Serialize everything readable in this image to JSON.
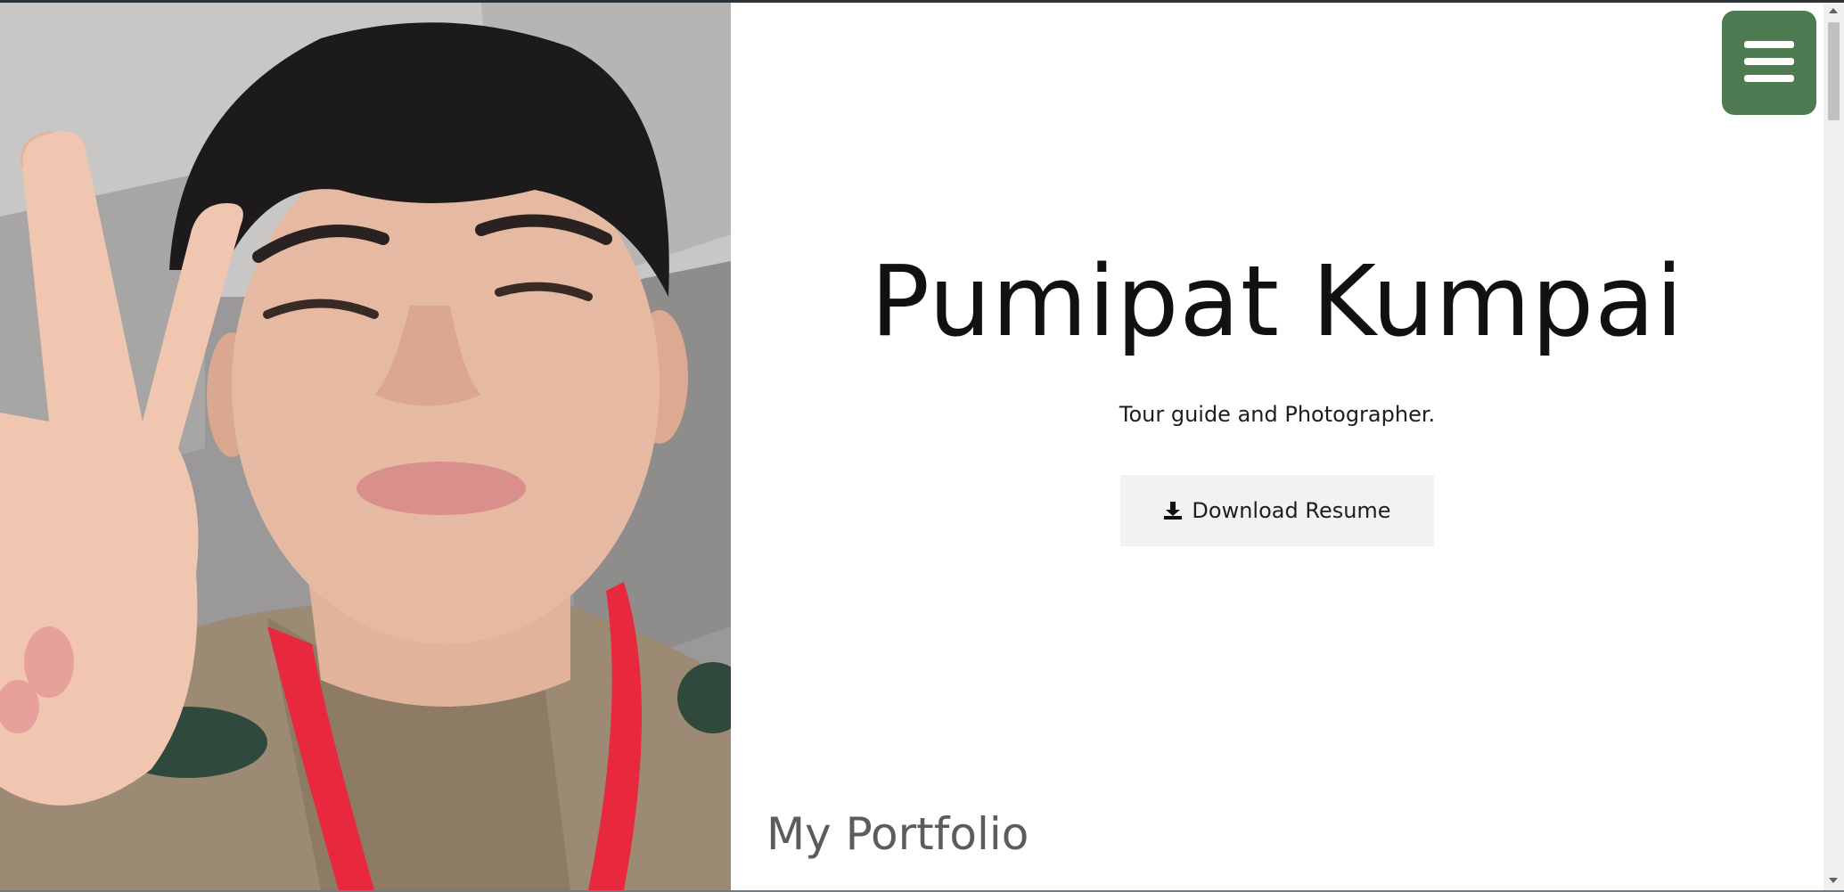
{
  "hero": {
    "name": "Pumipat Kumpai",
    "tagline": "Tour guide and Photographer.",
    "resume_button_label": "Download Resume",
    "resume_icon": "download-icon"
  },
  "sections": {
    "portfolio_heading": "My Portfolio"
  },
  "menu": {
    "icon": "hamburger-menu-icon"
  },
  "colors": {
    "menu_button_bg": "#4e7a52",
    "resume_button_bg": "#f2f2f2",
    "title_text": "#111111",
    "heading_text": "#5c5c5c"
  }
}
